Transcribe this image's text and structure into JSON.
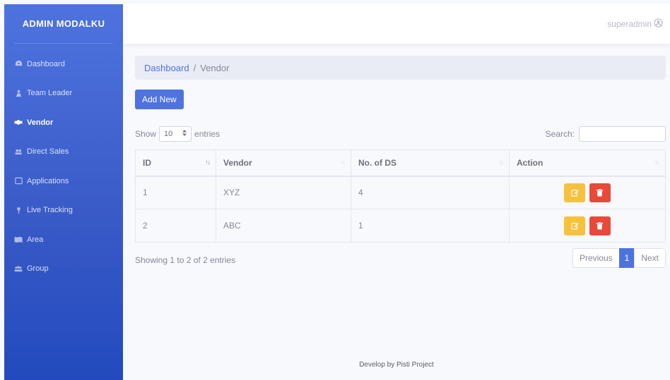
{
  "brand": "ADMIN MODALKU",
  "sidebar": {
    "items": [
      {
        "label": "Dashboard",
        "icon": "dashboard-icon"
      },
      {
        "label": "Team Leader",
        "icon": "team-icon"
      },
      {
        "label": "Vendor",
        "icon": "handshake-icon",
        "active": true
      },
      {
        "label": "Direct Sales",
        "icon": "users-icon"
      },
      {
        "label": "Applications",
        "icon": "window-icon"
      },
      {
        "label": "Live Tracking",
        "icon": "map-pin-icon"
      },
      {
        "label": "Area",
        "icon": "map-icon"
      },
      {
        "label": "Group",
        "icon": "group-icon"
      }
    ]
  },
  "topbar": {
    "user": "superadmin"
  },
  "breadcrumb": {
    "home": "Dashboard",
    "separator": "/",
    "current": "Vendor"
  },
  "toolbar": {
    "add_label": "Add New"
  },
  "controls": {
    "show_label": "Show",
    "page_size": "10",
    "entries_label": "entries",
    "search_label": "Search:",
    "search_value": ""
  },
  "table": {
    "headers": [
      "ID",
      "Vendor",
      "No. of DS",
      "Action"
    ],
    "rows": [
      {
        "id": "1",
        "vendor": "XYZ",
        "ds": "4"
      },
      {
        "id": "2",
        "vendor": "ABC",
        "ds": "1"
      }
    ]
  },
  "info": "Showing 1 to 2 of 2 entries",
  "pagination": {
    "previous": "Previous",
    "page": "1",
    "next": "Next"
  },
  "footer": "Develop by Pisti Project",
  "colors": {
    "primary": "#4e73df",
    "warning": "#f6c23e",
    "danger": "#e74a3b"
  }
}
